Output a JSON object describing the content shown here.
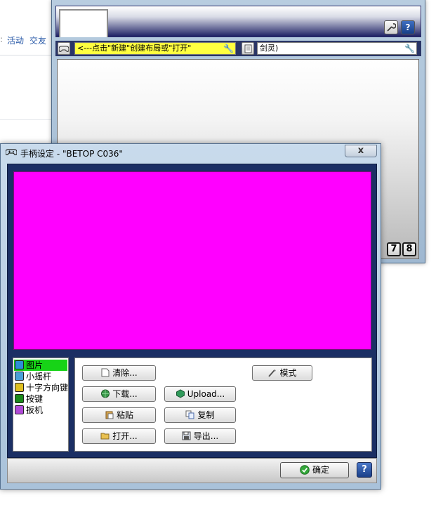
{
  "background_page": {
    "nav": [
      "活动",
      "交友"
    ]
  },
  "layout_window": {
    "profile_field": "<---点击\"新建\"创建布局或\"打开\"",
    "game_field": "剑灵)",
    "page_buttons": [
      "7",
      "8"
    ],
    "help_label": "?"
  },
  "dialog": {
    "title": "手柄设定 - \"BETOP C036\"",
    "close_label": "x",
    "preview_color": "#ff00ff",
    "element_list": [
      {
        "label": "图片",
        "selected": true,
        "icon": "picture-icon",
        "color": "#2d8fd6"
      },
      {
        "label": "小摇杆",
        "selected": false,
        "icon": "joystick-icon",
        "color": "#4aa0d8"
      },
      {
        "label": "十字方向键",
        "selected": false,
        "icon": "dpad-icon",
        "color": "#e0c020"
      },
      {
        "label": "按键",
        "selected": false,
        "icon": "button-icon",
        "color": "#1a8a1a"
      },
      {
        "label": "扳机",
        "selected": false,
        "icon": "trigger-icon",
        "color": "#b04ad8"
      }
    ],
    "buttons": {
      "clear": "清除...",
      "mode": "模式",
      "download": "下载...",
      "upload": "Upload...",
      "paste": "粘贴",
      "copy": "复制",
      "open": "打开...",
      "export": "导出..."
    },
    "ok_label": "确定",
    "help_label": "?"
  }
}
